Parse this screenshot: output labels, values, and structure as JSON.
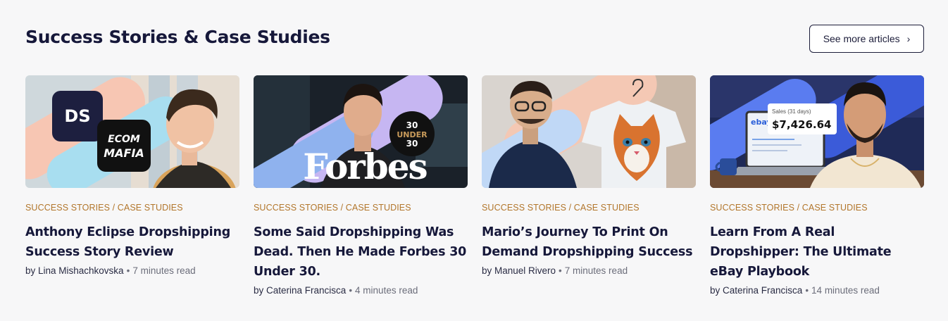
{
  "section": {
    "title": "Success Stories & Case Studies",
    "see_more_label": "See more articles"
  },
  "cards": [
    {
      "category": "SUCCESS STORIES / CASE STUDIES",
      "title": "Anthony Eclipse Dropshipping Success Story Review",
      "author": "by Lina Mishachkovska",
      "read_time": "7 minutes read",
      "thumb": {
        "badge1": "DS",
        "badge2_line1": "ECOM",
        "badge2_line2": "MAFIA"
      }
    },
    {
      "category": "SUCCESS STORIES / CASE STUDIES",
      "title": "Some Said Dropshipping Was Dead. Then He Made Forbes 30 Under 30.",
      "author": "by Caterina Francisca",
      "read_time": "4 minutes read",
      "thumb": {
        "logo": "Forbes",
        "badge_line1": "30",
        "badge_line2": "UNDER",
        "badge_line3": "30"
      }
    },
    {
      "category": "SUCCESS STORIES / CASE STUDIES",
      "title": "Mario’s Journey To Print On Demand Dropshipping Success",
      "author": "by Manuel Rivero",
      "read_time": "7 minutes read",
      "thumb": {}
    },
    {
      "category": "SUCCESS STORIES / CASE STUDIES",
      "title": "Learn From A Real Dropshipper: The Ultimate eBay Playbook",
      "author": "by Caterina Francisca",
      "read_time": "14 minutes read",
      "thumb": {
        "sales_label": "Sales (31 days)",
        "sales_value": "$7,426.64",
        "brand": "ebay"
      }
    }
  ]
}
